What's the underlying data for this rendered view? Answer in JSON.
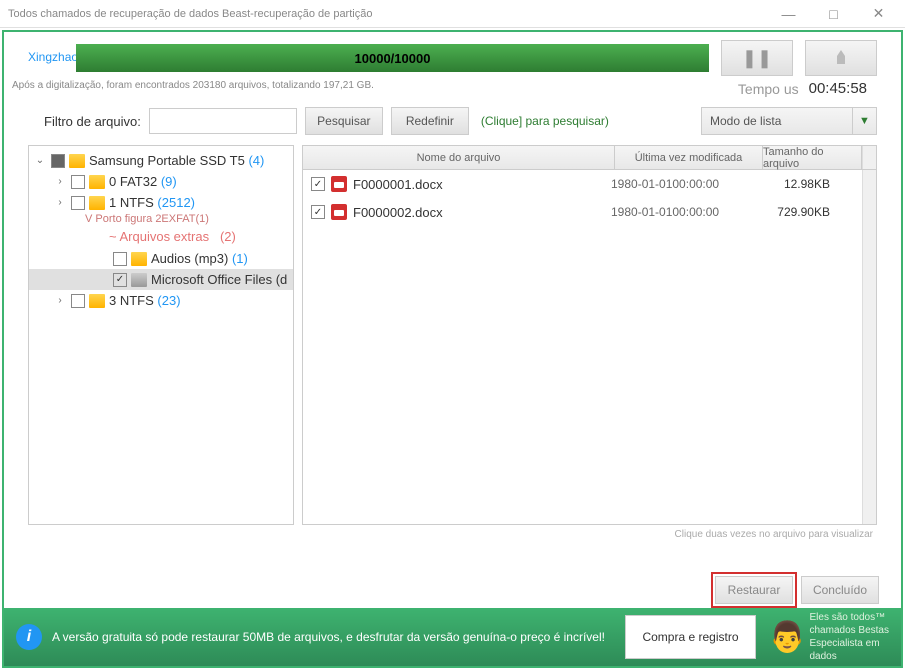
{
  "titlebar": {
    "title": "Todos chamados de recuperação de dados Beast-recuperação de partição"
  },
  "progress": {
    "label": "Xingzhao",
    "text": "10000/10000",
    "time_label": "Tempo us",
    "time_value": "00:45:58"
  },
  "scan": {
    "info": "Após a digitalização, foram encontrados 203180 arquivos, totalizando 197,21 GB."
  },
  "filter": {
    "label": "Filtro de arquivo:",
    "search_btn": "Pesquisar",
    "reset_btn": "Redefinir",
    "hint": "(Clique] para pesquisar)",
    "list_mode": "Modo de lista"
  },
  "tree": {
    "root": {
      "name": "Samsung Portable SSD T5",
      "count": "(4)"
    },
    "items": [
      {
        "name": "0 FAT32",
        "count": "(9)"
      },
      {
        "name": "1 NTFS",
        "count": "(2512)"
      }
    ],
    "sub_label": "V Porto figura 2EXFAT(1)",
    "extras": {
      "label": "~ Arquivos extras",
      "count": "(2)"
    },
    "extra_items": [
      {
        "name": "Audios (mp3)",
        "count": "(1)"
      },
      {
        "name": "Microsoft Office Files (d"
      }
    ],
    "last": {
      "name": "3 NTFS",
      "count": "(23)"
    }
  },
  "file_headers": {
    "name": "Nome do arquivo",
    "date": "Última vez modificada",
    "size": "Tamanho do arquivo"
  },
  "files": [
    {
      "name": "F0000001.docx",
      "date": "1980-01-0100:00:00",
      "size": "12.98KB"
    },
    {
      "name": "F0000002.docx",
      "date": "1980-01-0100:00:00",
      "size": "729.90KB"
    }
  ],
  "preview_hint": "Clique duas vezes no arquivo para visualizar",
  "actions": {
    "restore": "Restaurar",
    "done": "Concluído"
  },
  "footer": {
    "text": "A versão gratuita só pode restaurar 50MB de arquivos, e desfrutar da versão genuína-o preço é incrível!",
    "buy_btn": "Compra e registro",
    "right_text": "Eles são todos™\nchamados Bestas\nEspecialista em\ndados"
  }
}
